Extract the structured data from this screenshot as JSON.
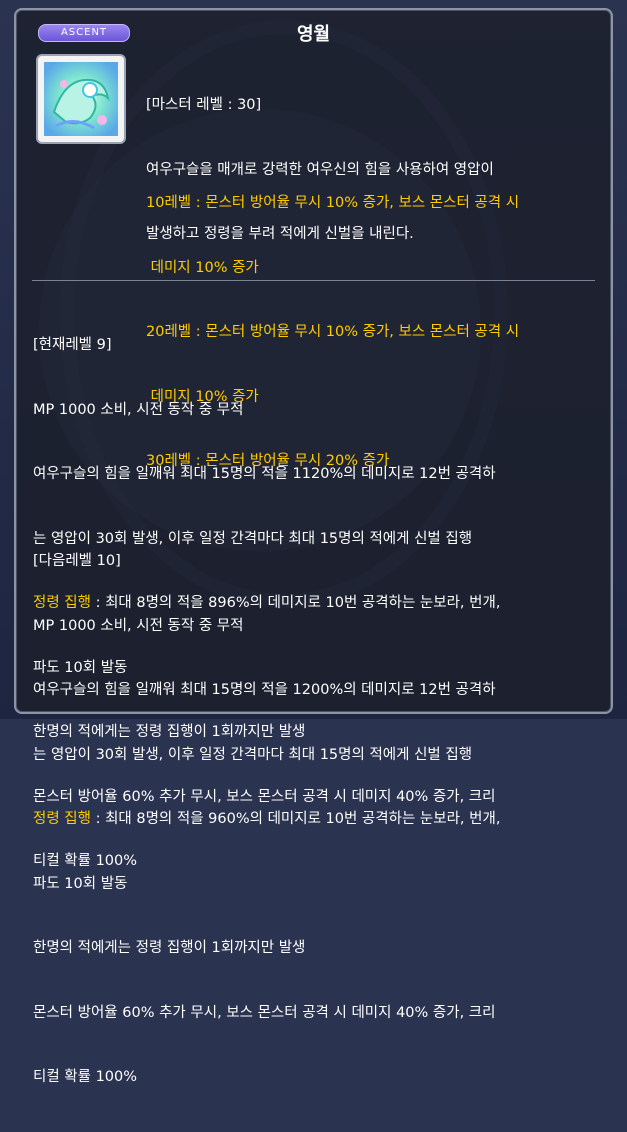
{
  "tooltip": {
    "badge": "ASCENT",
    "title": "영월",
    "master_level": "[마스터 레벨 : 30]",
    "description": [
      "여우구슬을 매개로 강력한 여우신의 힘을 사용하여 영압이",
      "발생하고 정령을 부려 적에게 신벌을 내린다."
    ],
    "level_bonuses": [
      "10레벨 : 몬스터 방어율 무시 10% 증가, 보스 몬스터 공격 시",
      " 데미지 10% 증가",
      "20레벨 : 몬스터 방어율 무시 10% 증가, 보스 몬스터 공격 시",
      " 데미지 10% 증가",
      "30레벨 : 몬스터 방어율 무시 20% 증가"
    ],
    "current_level": {
      "header": "[현재레벨 9]",
      "lines": [
        "MP 1000 소비, 시전 동작 중 무적",
        "여우구슬의 힘을 일깨워 최대 15명의 적을 1120%의 데미지로 12번 공격하",
        "는 영압이 30회 발생, 이후 일정 간격마다 최대 15명의 적에게 신벌 집행"
      ],
      "spirit_label": "정령 집행",
      "spirit_text": " : 최대 8명의 적을 896%의 데미지로 10번 공격하는 눈보라, 번개,",
      "spirit_text2": "파도 10회 발동",
      "tail": [
        "한명의 적에게는 정령 집행이 1회까지만 발생",
        "몬스터 방어율 60% 추가 무시, 보스 몬스터 공격 시 데미지 40% 증가, 크리",
        "티컬 확률 100%"
      ]
    },
    "next_level": {
      "header": "[다음레벨 10]",
      "lines": [
        "MP 1000 소비, 시전 동작 중 무적",
        "여우구슬의 힘을 일깨워 최대 15명의 적을 1200%의 데미지로 12번 공격하",
        "는 영압이 30회 발생, 이후 일정 간격마다 최대 15명의 적에게 신벌 집행"
      ],
      "spirit_label": "정령 집행",
      "spirit_text": " : 최대 8명의 적을 960%의 데미지로 10번 공격하는 눈보라, 번개,",
      "spirit_text2": "파도 10회 발동",
      "tail": [
        "한명의 적에게는 정령 집행이 1회까지만 발생",
        "몬스터 방어율 60% 추가 무시, 보스 몬스터 공격 시 데미지 40% 증가, 크리",
        "티컬 확률 100%"
      ]
    },
    "icon": "fox-spirit-skill-icon",
    "colors": {
      "highlight": "#ffcc00",
      "text": "#ffffff",
      "badge": "#7a66e0"
    }
  }
}
